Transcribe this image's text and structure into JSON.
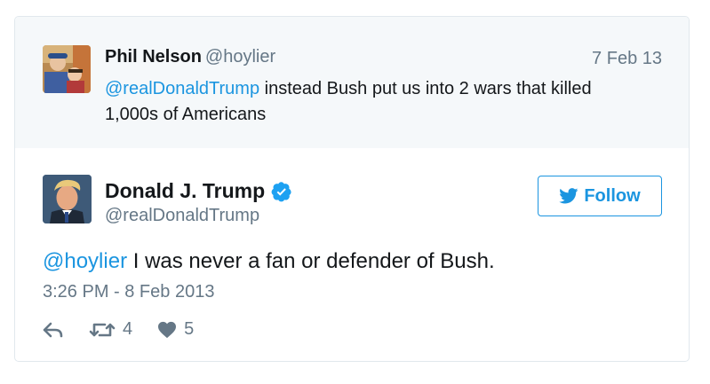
{
  "parent_tweet": {
    "author_name": "Phil Nelson",
    "author_handle": "@hoylier",
    "date": "7 Feb 13",
    "mention": "@realDonaldTrump",
    "text": " instead Bush put us into 2 wars that killed 1,000s of Americans",
    "avatar_icon": "user-photo"
  },
  "main_tweet": {
    "author_name": "Donald J. Trump",
    "author_handle": "@realDonaldTrump",
    "verified_icon": "verified-badge-icon",
    "follow_label": "Follow",
    "mention": "@hoylier",
    "text": " I was never a fan or defender of Bush.",
    "timestamp": "3:26 PM - 8 Feb 2013",
    "retweet_count": "4",
    "like_count": "5"
  },
  "colors": {
    "accent": "#1b95e0",
    "muted": "#657786",
    "parent_bg": "#f5f8fa",
    "border": "#e1e8ed"
  }
}
